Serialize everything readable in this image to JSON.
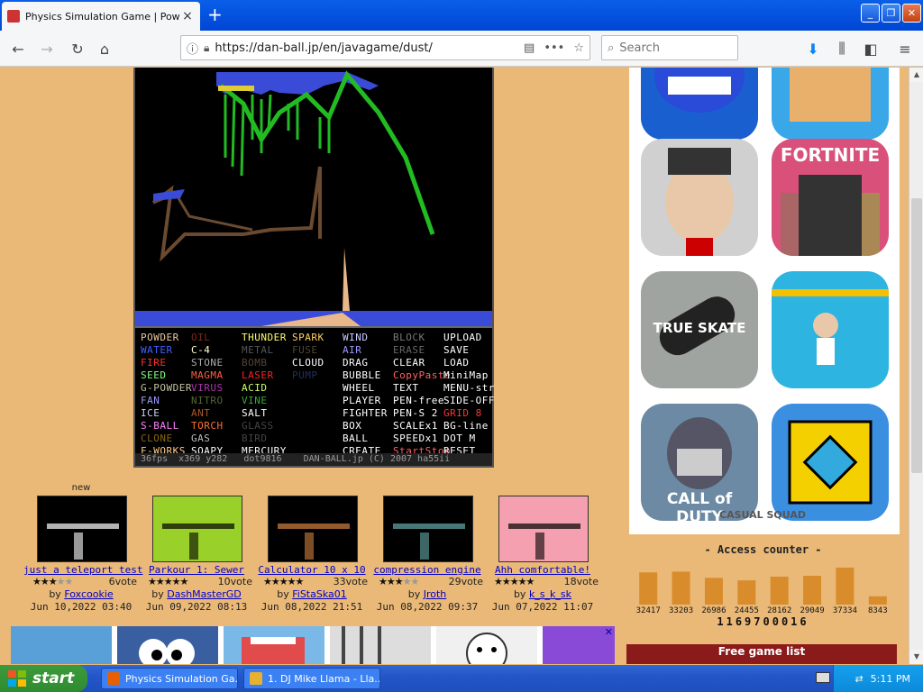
{
  "browser": {
    "tab_title": "Physics Simulation Game | Powder Game",
    "tab_close": "×",
    "new_tab": "+",
    "url": "https://dan-ball.jp/en/javagame/dust/",
    "search_placeholder": "Search",
    "window_buttons": [
      "_",
      "❐",
      "✕"
    ]
  },
  "game": {
    "menu": [
      [
        {
          "t": "POWDER",
          "c": "#e8c8a0"
        },
        {
          "t": "OIL",
          "c": "#7a2a1a"
        },
        {
          "t": "THUNDER",
          "c": "#ffff66"
        },
        {
          "t": "SPARK",
          "c": "#ffd060"
        },
        {
          "t": "WIND",
          "c": "#ccccff",
          "dot": true
        },
        {
          "t": "BLOCK",
          "c": "#777777"
        },
        {
          "t": "UPLOAD",
          "c": "#ffffff"
        }
      ],
      [
        {
          "t": "WATER",
          "c": "#4060ff"
        },
        {
          "t": "C-4",
          "c": "#ffffcc"
        },
        {
          "t": "METAL",
          "c": "#555555"
        },
        {
          "t": "FUSE",
          "c": "#554433"
        },
        {
          "t": "AIR",
          "c": "#9999ff"
        },
        {
          "t": "ERASE",
          "c": "#666666"
        },
        {
          "t": "SAVE",
          "c": "#ffffff"
        }
      ],
      [
        {
          "t": "FIRE",
          "c": "#ff3030"
        },
        {
          "t": "STONE",
          "c": "#aaaaaa"
        },
        {
          "t": "BOMB",
          "c": "#554433"
        },
        {
          "t": "CLOUD",
          "c": "#ffffff"
        },
        {
          "t": "DRAG",
          "c": "#ffffff"
        },
        {
          "t": "CLEAR",
          "c": "#ffffff"
        },
        {
          "t": "LOAD",
          "c": "#ffffff"
        }
      ],
      [
        {
          "t": "SEED",
          "c": "#80ff80"
        },
        {
          "t": "MAGMA",
          "c": "#ff6040"
        },
        {
          "t": "LASER",
          "c": "#ff2020"
        },
        {
          "t": "PUMP",
          "c": "#203060"
        },
        {
          "t": "BUBBLE",
          "c": "#ffffff"
        },
        {
          "t": "CopyPaste",
          "c": "#ff6060"
        },
        {
          "t": "MiniMap",
          "c": "#ffffff"
        }
      ],
      [
        {
          "t": "G-POWDER",
          "c": "#c0c0a0"
        },
        {
          "t": "VIRUS",
          "c": "#aa33aa"
        },
        {
          "t": "ACID",
          "c": "#ccff66"
        },
        {
          "t": "",
          "c": "#ffffff"
        },
        {
          "t": "WHEEL",
          "c": "#ffffff"
        },
        {
          "t": "TEXT",
          "c": "#ffffff"
        },
        {
          "t": "MENU-str",
          "c": "#ffffff"
        }
      ],
      [
        {
          "t": "FAN",
          "c": "#9999ff"
        },
        {
          "t": "NITRO",
          "c": "#556633"
        },
        {
          "t": "VINE",
          "c": "#33aa33"
        },
        {
          "t": "",
          "c": "#ffffff"
        },
        {
          "t": "PLAYER",
          "c": "#ffffff"
        },
        {
          "t": "PEN-free",
          "c": "#ffffff"
        },
        {
          "t": "SIDE-OFF",
          "c": "#ffffff"
        }
      ],
      [
        {
          "t": "ICE",
          "c": "#ccccff"
        },
        {
          "t": "ANT",
          "c": "#aa5522"
        },
        {
          "t": "SALT",
          "c": "#ffffff"
        },
        {
          "t": "",
          "c": "#ffffff"
        },
        {
          "t": "FIGHTER",
          "c": "#ffffff"
        },
        {
          "t": "PEN-S 2",
          "c": "#ffffff"
        },
        {
          "t": "GRID 8",
          "c": "#ff3333"
        }
      ],
      [
        {
          "t": "S-BALL",
          "c": "#ff80ff"
        },
        {
          "t": "TORCH",
          "c": "#ff7030"
        },
        {
          "t": "GLASS",
          "c": "#444444"
        },
        {
          "t": "",
          "c": "#ffffff"
        },
        {
          "t": "BOX",
          "c": "#ffffff"
        },
        {
          "t": "SCALEx1",
          "c": "#ffffff"
        },
        {
          "t": "BG-line",
          "c": "#ffffff"
        }
      ],
      [
        {
          "t": "CLONE",
          "c": "#886611"
        },
        {
          "t": "GAS",
          "c": "#bbbbbb"
        },
        {
          "t": "BIRD",
          "c": "#444444"
        },
        {
          "t": "",
          "c": "#ffffff"
        },
        {
          "t": "BALL",
          "c": "#ffffff"
        },
        {
          "t": "SPEEDx1",
          "c": "#ffffff"
        },
        {
          "t": "DOT M",
          "c": "#ffffff"
        }
      ],
      [
        {
          "t": "F-WORKS",
          "c": "#ffcc88"
        },
        {
          "t": "SOAPY",
          "c": "#ffffff"
        },
        {
          "t": "MERCURY",
          "c": "#ffffff"
        },
        {
          "t": "",
          "c": "#ffffff"
        },
        {
          "t": "CREATE",
          "c": "#ffffff"
        },
        {
          "t": "StartStop",
          "c": "#ff6060"
        },
        {
          "t": "RESET",
          "c": "#ffffff"
        }
      ]
    ],
    "status": "36fps  x369 y282   dot9816    DAN-BALL.jp (C) 2007 ha55ii"
  },
  "uploads": [
    {
      "new": "new",
      "title": "just a teleport test",
      "stars": 3,
      "votes": "6vote",
      "by": "by",
      "author": "Foxcookie",
      "date": "Jun 10,2022 03:40"
    },
    {
      "new": "",
      "title": "Parkour 1: Sewer",
      "stars": 5,
      "votes": "10vote",
      "by": "by",
      "author": "DashMasterGD",
      "date": "Jun 09,2022 08:13"
    },
    {
      "new": "",
      "title": "Calculator 10 x 10",
      "stars": 5,
      "votes": "33vote",
      "by": "by",
      "author": "FiStaSka01",
      "date": "Jun 08,2022 21:51"
    },
    {
      "new": "",
      "title": "compression engine",
      "stars": 3,
      "votes": "29vote",
      "by": "by",
      "author": "Jroth",
      "date": "Jun 08,2022 09:37"
    },
    {
      "new": "",
      "title": "Ahh comfortable!",
      "stars": 5,
      "votes": "18vote",
      "by": "by",
      "author": "k_s_k_sk",
      "date": "Jun 07,2022 11:07"
    }
  ],
  "ads": {
    "apps": [
      {
        "name": "poppy-playtime",
        "label": "",
        "bg": "#1a5fd0"
      },
      {
        "name": "bread",
        "label": "",
        "bg": "#3aa8e8"
      },
      {
        "name": "scary-teacher",
        "label": "",
        "bg": "#d0d0d0"
      },
      {
        "name": "fortnite",
        "label": "FORTNITE",
        "bg": "#d9507a"
      },
      {
        "name": "true-skate",
        "label": "TRUE SKATE",
        "bg": "#a0a4a0"
      },
      {
        "name": "pull-pin",
        "label": "",
        "bg": "#2db4e0"
      },
      {
        "name": "call-of-duty",
        "label": "CALL of DUTY",
        "bg": "#6d8aa5"
      },
      {
        "name": "geometry-dash",
        "label": "",
        "bg": "#3a8fe0"
      }
    ],
    "casual_squad": "CASUAL SQUAD",
    "adchoice": "✕"
  },
  "counter": {
    "title": "- Access counter -",
    "total": "1169700016",
    "bar_color": "#d98c2b"
  },
  "chart_data": {
    "type": "bar",
    "title": "- Access counter -",
    "categories": [
      "32417",
      "33203",
      "26986",
      "24455",
      "28162",
      "29049",
      "37334",
      "8343"
    ],
    "values": [
      32417,
      33203,
      26986,
      24455,
      28162,
      29049,
      37334,
      8343
    ],
    "xlabel": "",
    "ylabel": "",
    "ylim": [
      0,
      40000
    ]
  },
  "gamelist": {
    "title": "Free game list"
  },
  "taskbar": {
    "start": "start",
    "tasks": [
      "Physics Simulation Ga...",
      "1. DJ Mike Llama - Lla..."
    ],
    "clock": "5:11 PM"
  }
}
